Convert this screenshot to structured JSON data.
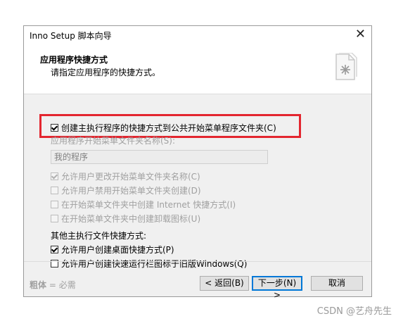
{
  "window": {
    "title": "Inno Setup 脚本向导",
    "close_glyph": "✕"
  },
  "header": {
    "title": "应用程序快捷方式",
    "subtitle": "请指定应用程序的快捷方式。",
    "icon": "document-star-icon"
  },
  "options": {
    "create_start_menu": {
      "label": "创建主执行程序的快捷方式到公共开始菜单程序文件夹(C)",
      "checked": true
    },
    "folder_label": "应用程序开始菜单文件夹名称(S):",
    "folder_value": "我的程序",
    "allow_change_name": {
      "label": "允许用户更改开始菜单文件夹名称(C)",
      "checked": true,
      "enabled": false
    },
    "allow_disable": {
      "label": "允许用户禁用开始菜单文件夹创建(D)",
      "checked": false,
      "enabled": false
    },
    "internet_shortcut": {
      "label": "在开始菜单文件夹中创建 Internet 快捷方式(I)",
      "checked": false,
      "enabled": false
    },
    "uninstall_icon": {
      "label": "在开始菜单文件夹中创建卸载图标(U)",
      "checked": false,
      "enabled": false
    },
    "other_label": "其他主执行文件快捷方式:",
    "desktop": {
      "label": "允许用户创建桌面快捷方式(P)",
      "checked": true
    },
    "quicklaunch": {
      "label": "允许用户创建快速运行栏图标于旧版Windows(Q)",
      "checked": false
    }
  },
  "footer": {
    "bold_text": "粗体",
    "note_rest": " = 必需",
    "back": "< 返回(B)",
    "next": "下一步(N) >",
    "cancel": "取消"
  },
  "watermark": "CSDN @艺舟先生",
  "colors": {
    "highlight": "#e3262f",
    "primary_button_border": "#0078d7"
  }
}
